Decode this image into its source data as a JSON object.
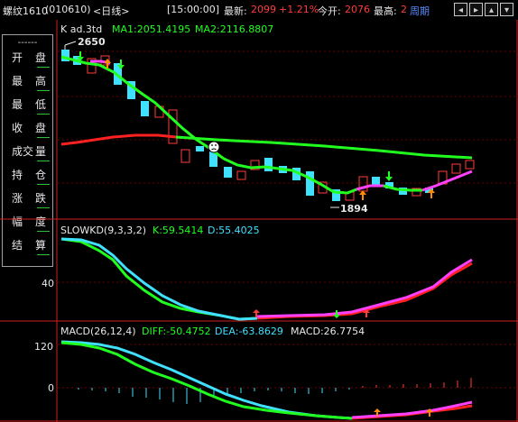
{
  "header": {
    "symbol": "螺纹1610",
    "code": "(010610)",
    "period": "<日线>",
    "time": "[15:00:00]",
    "latest_label": "最新:",
    "latest_value": "2099",
    "change": "+1.21%",
    "open_label": "今开:",
    "open_value": "2076",
    "high_label": "最高:",
    "high_value": "2",
    "cycle_button": "周期",
    "toolbar_icons": [
      "arrow-left-icon",
      "arrow-right-icon",
      "zoom-in-icon",
      "zoom-out-icon"
    ]
  },
  "sidebar": {
    "divider": "------",
    "items": [
      {
        "label_a": "开",
        "label_b": "盘"
      },
      {
        "label_a": "最",
        "label_b": "高"
      },
      {
        "label_a": "最",
        "label_b": "低"
      },
      {
        "label_a": "收",
        "label_b": "盘"
      },
      {
        "label_a": "成交",
        "label_b": "量"
      },
      {
        "label_a": "持",
        "label_b": "仓"
      },
      {
        "label_a": "涨",
        "label_b": "跌"
      },
      {
        "label_a": "幅",
        "label_b": "度"
      },
      {
        "label_a": "结",
        "label_b": "算"
      }
    ]
  },
  "price_panel": {
    "title": "K  ad.3td",
    "ma1": "MA1:2051.4195",
    "ma2": "MA2:2116.8807",
    "high_marker": "2650",
    "low_marker": "1894",
    "emoji": "sad-face-icon"
  },
  "kd_panel": {
    "title": "SLOWKD(9,3,3,2)",
    "k": "K:59.5414",
    "d": "D:55.4025",
    "tick": "40"
  },
  "macd_panel": {
    "title": "MACD(26,12,4)",
    "diff": "DIFF:-50.4752",
    "dea": "DEA:-63.8629",
    "macd": "MACD:26.7754",
    "ticks": [
      "120",
      "0"
    ]
  },
  "colors": {
    "up": "#ff3c3c",
    "down": "#40e0ff",
    "ma1": "#20ff20",
    "ma2": "#ff2020",
    "signal": "#ff40ff",
    "grid": "#6a0000"
  }
}
